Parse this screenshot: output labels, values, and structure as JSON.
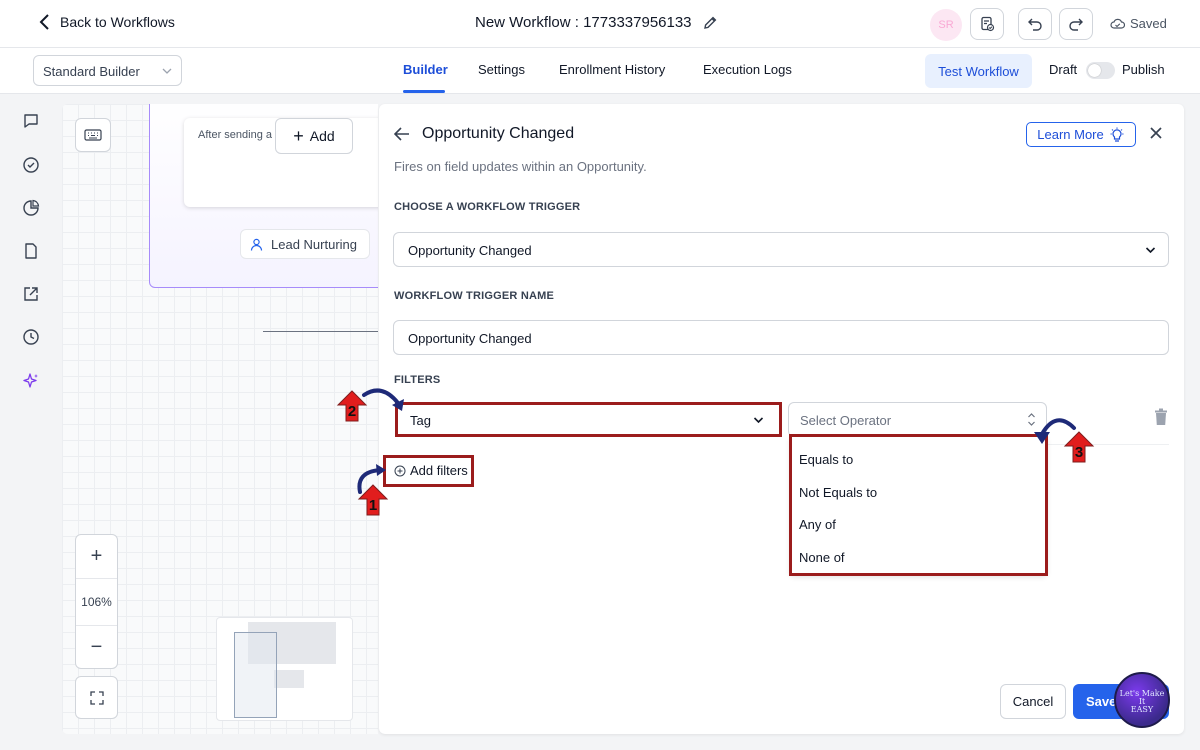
{
  "topbar": {
    "back_label": "Back to Workflows",
    "workflow_title": "New Workflow : 1773337956133",
    "avatar_initials": "SR",
    "saved_label": "Saved"
  },
  "subbar": {
    "builder_select": "Standard Builder",
    "tabs": [
      {
        "label": "Builder",
        "active": true
      },
      {
        "label": "Settings",
        "active": false
      },
      {
        "label": "Enrollment History",
        "active": false
      },
      {
        "label": "Execution Logs",
        "active": false
      }
    ],
    "test_workflow_label": "Test Workflow",
    "draft_label": "Draft",
    "publish_label": "Publish"
  },
  "canvas": {
    "node_text": "After sending a",
    "add_label": "Add",
    "lead_label": "Lead Nurturing",
    "zoom_level": "106%",
    "zoom_in": "+",
    "zoom_out": "−"
  },
  "panel": {
    "title": "Opportunity Changed",
    "subtitle": "Fires on field updates within an Opportunity.",
    "learn_more": "Learn More",
    "trigger_section": "CHOOSE A WORKFLOW TRIGGER",
    "trigger_value": "Opportunity Changed",
    "name_section": "WORKFLOW TRIGGER NAME",
    "name_value": "Opportunity Changed",
    "filters_section": "FILTERS",
    "filter_field": "Tag",
    "filter_operator_placeholder": "Select Operator",
    "add_filters": "Add filters",
    "operator_options": [
      "Equals to",
      "Not Equals to",
      "Any of",
      "None of"
    ],
    "cancel_label": "Cancel",
    "save_label": "Save"
  },
  "annotations": {
    "step1": "1",
    "step2": "2",
    "step3": "3",
    "highlight_color": "#9b1c1c",
    "badge_color": "#e11d1d",
    "watermark": [
      "Let's Make",
      "It",
      "EASY"
    ]
  },
  "colors": {
    "accent": "#2563eb",
    "canvas_frame": "#a78bfa"
  }
}
